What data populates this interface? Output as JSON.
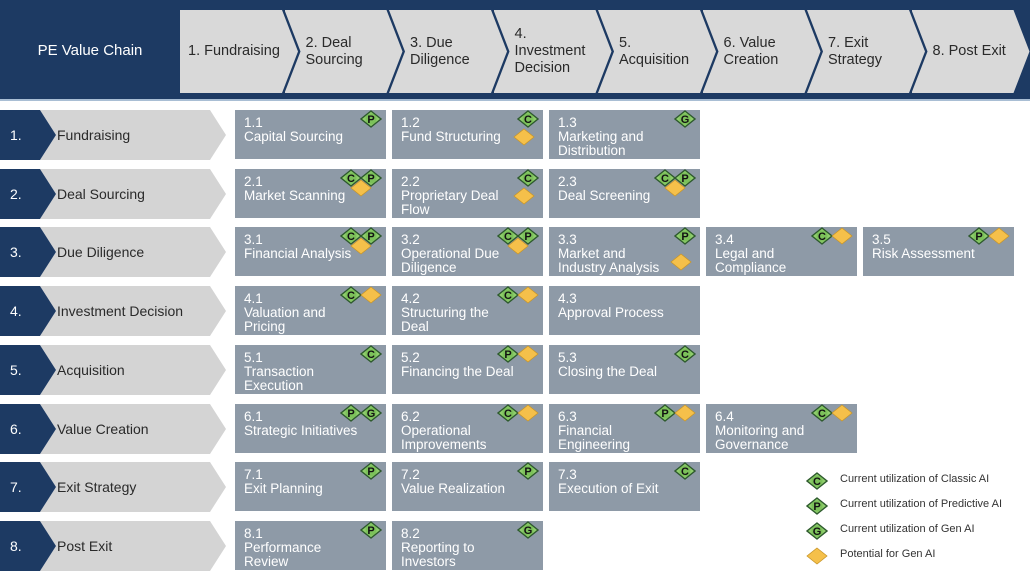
{
  "colors": {
    "navy": "#1d3a63",
    "stage_gray": "#d9d9d9",
    "card_gray": "#8e9aa7",
    "badge_green": "#8fce6c",
    "badge_green_border": "#2e5a2e",
    "potential_gold": "#f5c04a"
  },
  "header": {
    "title": "PE Value Chain",
    "stages": [
      {
        "label_lines": [
          "1. Fundraising"
        ]
      },
      {
        "label_lines": [
          "2. Deal",
          "Sourcing"
        ]
      },
      {
        "label_lines": [
          "3. Due",
          "Diligence"
        ]
      },
      {
        "label_lines": [
          "4.",
          "Investment",
          "Decision"
        ]
      },
      {
        "label_lines": [
          "5.",
          "Acquisition"
        ]
      },
      {
        "label_lines": [
          "6. Value",
          "Creation"
        ]
      },
      {
        "label_lines": [
          "7. Exit",
          "Strategy"
        ]
      },
      {
        "label_lines": [
          "8. Post Exit"
        ]
      }
    ]
  },
  "rows": [
    {
      "num": "1.",
      "label": "Fundraising",
      "cards": [
        {
          "id": "1.1",
          "name": "Capital Sourcing",
          "badges": [
            "P"
          ]
        },
        {
          "id": "1.2",
          "name": "Fund Structuring",
          "badges": [
            "C",
            "potential"
          ]
        },
        {
          "id": "1.3",
          "name": "Marketing and Distribution",
          "badges": [
            "G"
          ]
        }
      ]
    },
    {
      "num": "2.",
      "label": "Deal Sourcing",
      "cards": [
        {
          "id": "2.1",
          "name": "Market Scanning",
          "badges": [
            "C",
            "P",
            "potential"
          ]
        },
        {
          "id": "2.2",
          "name": "Proprietary Deal Flow",
          "badges": [
            "C",
            "potential"
          ]
        },
        {
          "id": "2.3",
          "name": "Deal Screening",
          "badges": [
            "C",
            "P",
            "potential"
          ]
        }
      ]
    },
    {
      "num": "3.",
      "label": "Due Diligence",
      "cards": [
        {
          "id": "3.1",
          "name": "Financial Analysis",
          "badges": [
            "C",
            "P",
            "potential"
          ]
        },
        {
          "id": "3.2",
          "name": "Operational Due Diligence",
          "badges": [
            "C",
            "P",
            "potential"
          ]
        },
        {
          "id": "3.3",
          "name": "Market and Industry Analysis",
          "badges": [
            "P",
            "potential"
          ]
        },
        {
          "id": "3.4",
          "name": "Legal and Compliance Review",
          "badges": [
            "C",
            "potential"
          ]
        },
        {
          "id": "3.5",
          "name": "Risk Assessment",
          "badges": [
            "P",
            "potential"
          ]
        }
      ]
    },
    {
      "num": "4.",
      "label": "Investment Decision",
      "cards": [
        {
          "id": "4.1",
          "name": "Valuation and Pricing",
          "badges": [
            "C",
            "potential"
          ]
        },
        {
          "id": "4.2",
          "name": "Structuring the Deal",
          "badges": [
            "C",
            "potential"
          ]
        },
        {
          "id": "4.3",
          "name": "Approval Process",
          "badges": []
        }
      ]
    },
    {
      "num": "5.",
      "label": "Acquisition",
      "cards": [
        {
          "id": "5.1",
          "name": "Transaction Execution",
          "badges": [
            "C"
          ]
        },
        {
          "id": "5.2",
          "name": "Financing the Deal",
          "badges": [
            "P",
            "potential"
          ]
        },
        {
          "id": "5.3",
          "name": "Closing the Deal",
          "badges": [
            "C"
          ]
        }
      ]
    },
    {
      "num": "6.",
      "label": "Value Creation",
      "cards": [
        {
          "id": "6.1",
          "name": "Strategic Initiatives",
          "badges": [
            "P",
            "G"
          ]
        },
        {
          "id": "6.2",
          "name": "Operational Improvements",
          "badges": [
            "C",
            "potential"
          ]
        },
        {
          "id": "6.3",
          "name": "Financial Engineering",
          "badges": [
            "P",
            "potential"
          ]
        },
        {
          "id": "6.4",
          "name": "Monitoring and Governance",
          "badges": [
            "C",
            "potential"
          ]
        }
      ]
    },
    {
      "num": "7.",
      "label": "Exit Strategy",
      "cards": [
        {
          "id": "7.1",
          "name": "Exit Planning",
          "badges": [
            "P"
          ]
        },
        {
          "id": "7.2",
          "name": "Value Realization",
          "badges": [
            "P"
          ]
        },
        {
          "id": "7.3",
          "name": "Execution of Exit",
          "badges": [
            "C"
          ]
        }
      ]
    },
    {
      "num": "8.",
      "label": "Post Exit",
      "cards": [
        {
          "id": "8.1",
          "name": "Performance Review",
          "badges": [
            "P"
          ]
        },
        {
          "id": "8.2",
          "name": "Reporting to Investors",
          "badges": [
            "G"
          ]
        }
      ]
    }
  ],
  "legend": [
    {
      "badge": "C",
      "label": "Current utilization of Classic AI"
    },
    {
      "badge": "P",
      "label": "Current utilization of Predictive AI"
    },
    {
      "badge": "G",
      "label": "Current utilization of Gen AI"
    },
    {
      "badge": "potential",
      "label": "Potential for Gen AI"
    }
  ]
}
